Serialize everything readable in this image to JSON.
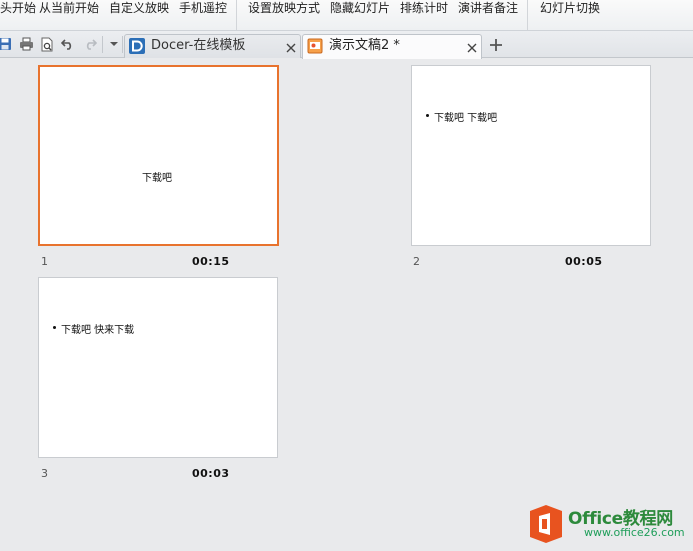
{
  "ribbon": {
    "buttons": [
      {
        "label": "从头开始",
        "id": "from-start"
      },
      {
        "label": "从当前开始",
        "id": "from-current"
      },
      {
        "label": "自定义放映",
        "id": "custom-show"
      },
      {
        "label": "手机遥控",
        "id": "phone-remote"
      },
      {
        "label": "设置放映方式",
        "id": "setup-show"
      },
      {
        "label": "隐藏幻灯片",
        "id": "hide-slide"
      },
      {
        "label": "排练计时",
        "id": "rehearse-timing"
      },
      {
        "label": "演讲者备注",
        "id": "speaker-notes"
      },
      {
        "label": "幻灯片切换",
        "id": "slide-transition"
      }
    ]
  },
  "tabs": [
    {
      "label": "Docer-在线模板",
      "state": "inactive",
      "icon": "docer-d-icon"
    },
    {
      "label": "演示文稿2 *",
      "state": "active",
      "icon": "presentation-icon"
    }
  ],
  "quick_access": [
    "save-icon",
    "print-icon",
    "print-preview-icon",
    "undo-icon",
    "redo-icon",
    "customize-dropdown-icon"
  ],
  "slides": [
    {
      "number": "1",
      "time": "00:15",
      "content": "下载吧",
      "layout": "title",
      "selected": true
    },
    {
      "number": "2",
      "time": "00:05",
      "content": "下载吧  下载吧",
      "layout": "bullet",
      "selected": false
    },
    {
      "number": "3",
      "time": "00:03",
      "content": "下载吧  快来下载",
      "layout": "bullet",
      "selected": false
    }
  ],
  "watermark": {
    "title": "Office教程网",
    "url": "www.office26.com"
  },
  "colors": {
    "selection": "#e8732e",
    "docer_blue": "#2c6fb7",
    "watermark_orange": "#e8531f",
    "watermark_green": "#2d8a3c"
  }
}
